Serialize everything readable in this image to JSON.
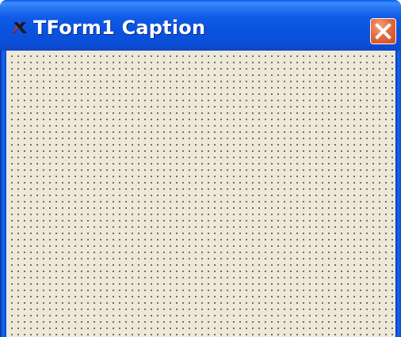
{
  "window": {
    "title": "TForm1 Caption",
    "icon": "x-app-icon",
    "close_icon": "close-icon",
    "titlebar_color": "#0a52de",
    "close_button_color": "#e36a3d",
    "client_color": "#ece9d8",
    "grid_dot_color": "#000000"
  }
}
